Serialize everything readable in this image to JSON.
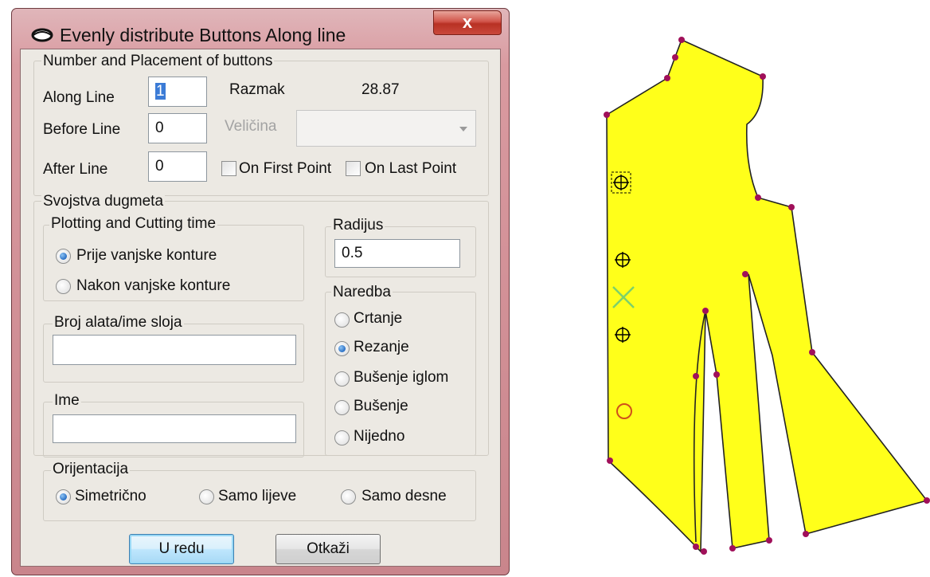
{
  "dialog": {
    "title": "Evenly distribute Buttons Along line",
    "close_glyph": "x",
    "placement": {
      "group_title": "Number and Placement of buttons",
      "along_line_label": "Along Line",
      "along_line_value": "1",
      "before_line_label": "Before Line",
      "before_line_value": "0",
      "after_line_label": "After Line",
      "after_line_value": "0",
      "spacing_label": "Razmak",
      "spacing_value": "28.87",
      "size_label": "Veličina",
      "size_value": "",
      "on_first_point_label": "On First Point",
      "on_first_point_checked": false,
      "on_last_point_label": "On Last Point",
      "on_last_point_checked": false
    },
    "properties": {
      "group_title": "Svojstva dugmeta",
      "plotting": {
        "group_title": "Plotting and Cutting time",
        "options": [
          "Prije vanjske konture",
          "Nakon vanjske konture"
        ],
        "selected": "Prije vanjske konture"
      },
      "radius": {
        "group_title": "Radijus",
        "value": "0.5"
      },
      "tool": {
        "group_title": "Broj alata/ime sloja",
        "value": ""
      },
      "name": {
        "group_title": "Ime",
        "value": ""
      },
      "command": {
        "group_title": "Naredba",
        "options": [
          "Crtanje",
          "Rezanje",
          "Bušenje iglom",
          "Bušenje",
          "Nijedno"
        ],
        "selected": "Rezanje"
      },
      "orientation": {
        "group_title": "Orijentacija",
        "options": [
          "Simetrično",
          "Samo lijeve",
          "Samo desne"
        ],
        "selected": "Simetrično"
      }
    },
    "ok_label": "U redu",
    "cancel_label": "Otkaži"
  },
  "colors": {
    "pattern_fill": "#ffff1a",
    "point_color": "#a0105a",
    "button_marker": "#000000",
    "cross_marker": "#7cd16a",
    "circle_marker": "#d0501a"
  }
}
